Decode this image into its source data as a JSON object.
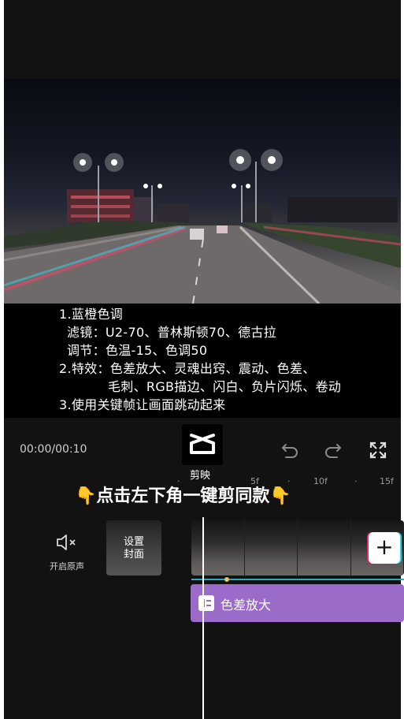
{
  "caption": {
    "line1": "1.蓝橙色调",
    "line2": "滤镜：U2-70、普林斯顿70、德古拉",
    "line3": "调节：色温-15、色调50",
    "line4": "2.特效：色差放大、灵魂出窍、震动、色差、",
    "line5": "毛刺、RGB描边、闪白、负片闪烁、卷动",
    "line6": "3.使用关键帧让画面跳动起来"
  },
  "player": {
    "time": "00:00/00:10"
  },
  "app": {
    "name": "剪映"
  },
  "ruler": {
    "marks": [
      "·",
      "5f",
      "·",
      "10f",
      "·",
      "15f"
    ]
  },
  "promo": {
    "hand_left": "👇",
    "text": "点击左下角一键剪同款",
    "hand_right": "👇"
  },
  "timeline": {
    "mute_label": "开启原声",
    "cover_line1": "设置",
    "cover_line2": "封面",
    "add_label": "+",
    "effect_label": "色差放大"
  },
  "colors": {
    "effect_track": "#9b6bc9",
    "track_line": "#2fa9b5",
    "background": "#121212"
  }
}
